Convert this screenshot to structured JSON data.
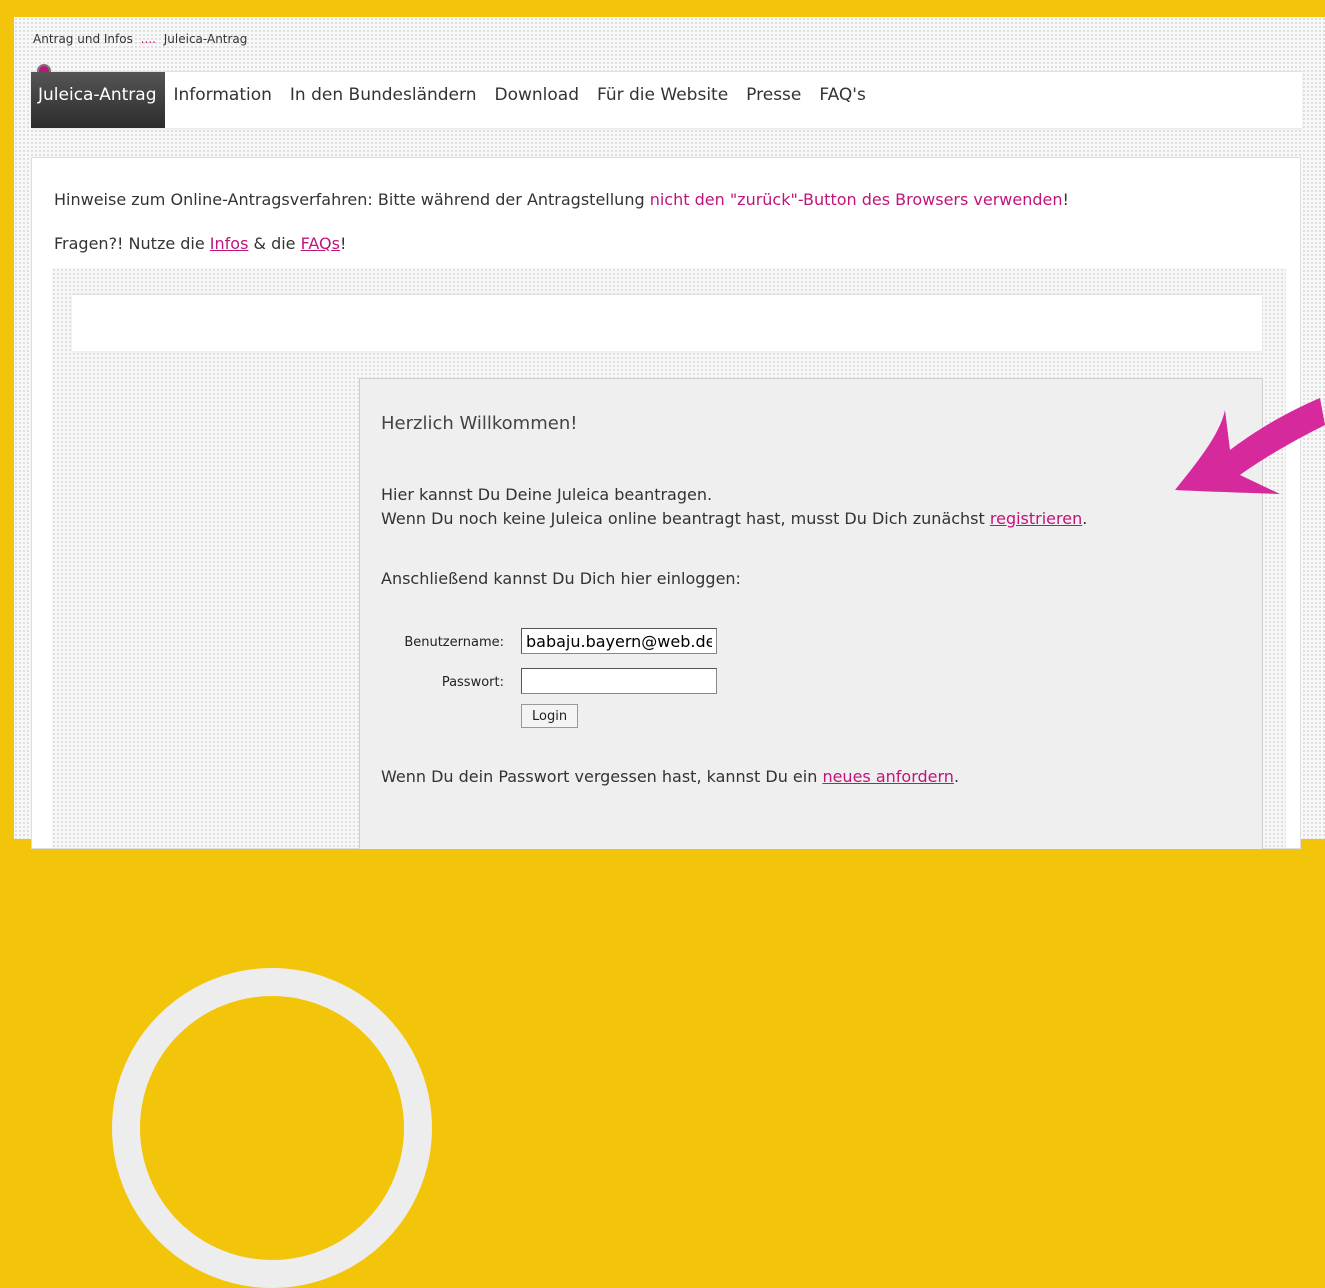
{
  "breadcrumb": {
    "first": "Antrag und Infos",
    "sep": "....",
    "current": "Juleica-Antrag"
  },
  "nav": {
    "items": [
      {
        "label": "Juleica-Antrag",
        "active": true
      },
      {
        "label": "Information"
      },
      {
        "label": "In den Bundesländern"
      },
      {
        "label": "Download"
      },
      {
        "label": "Für die Website"
      },
      {
        "label": "Presse"
      },
      {
        "label": "FAQ's"
      }
    ]
  },
  "hint": {
    "prefix": "Hinweise zum Online-Antragsverfahren: Bitte während der Antragstellung ",
    "highlight": "nicht den \"zurück\"-Button des Browsers verwenden",
    "suffix": "!"
  },
  "questions": {
    "prefix": "Fragen?! Nutze die ",
    "link_infos": "Infos",
    "middle": " & die ",
    "link_faqs": "FAQs",
    "suffix": "!"
  },
  "login": {
    "welcome": "Herzlich Willkommen!",
    "line1": "Hier kannst Du Deine Juleica beantragen.",
    "line2_prefix": "Wenn Du noch keine Juleica online beantragt hast, musst Du Dich zunächst ",
    "line2_link": "registrieren",
    "line2_suffix": ".",
    "line3": "Anschließend kannst Du Dich hier einloggen:",
    "username_label": "Benutzername:",
    "username_value": "babaju.bayern@web.de",
    "password_label": "Passwort:",
    "password_value": "",
    "login_button": "Login",
    "forgot_prefix": "Wenn Du dein Passwort vergessen hast, kannst Du ein ",
    "forgot_link": "neues anfordern",
    "forgot_suffix": "."
  },
  "colors": {
    "accent": "#c0147c",
    "frame": "#f3c50a",
    "arrow": "#d6299b"
  }
}
